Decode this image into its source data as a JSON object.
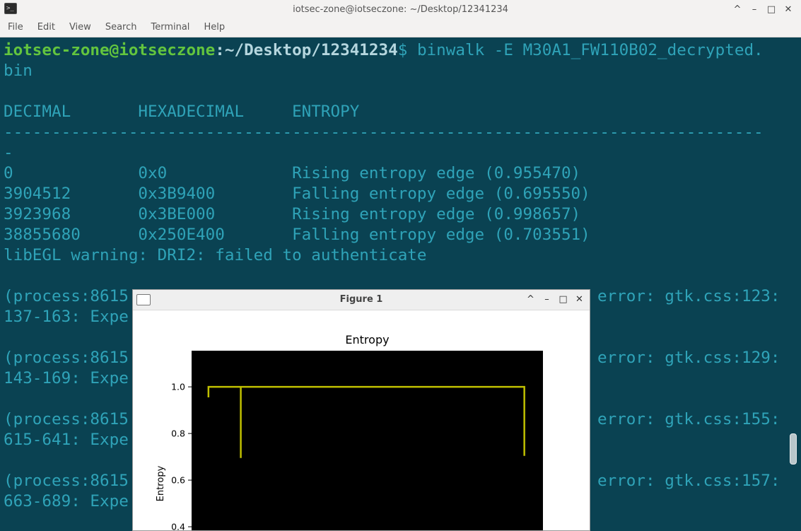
{
  "window": {
    "title": "iotsec-zone@iotseczone: ~/Desktop/12341234",
    "app_icon_glyph": ">_",
    "buttons": [
      "^",
      "–",
      "□",
      "✕"
    ]
  },
  "menu": [
    "File",
    "Edit",
    "View",
    "Search",
    "Terminal",
    "Help"
  ],
  "terminal": {
    "prompt_user": "iotsec-zone@iotseczone",
    "prompt_sep": ":",
    "prompt_path": "~/Desktop/12341234",
    "prompt_dollar": "$ ",
    "command": "binwalk -E M30A1_FW110B02_decrypted.",
    "command_wrap": "bin",
    "header": "DECIMAL       HEXADECIMAL     ENTROPY",
    "divider": "-------------------------------------------------------------------------------",
    "divider_wrap": "-",
    "rows": [
      "0             0x0             Rising entropy edge (0.955470)",
      "3904512       0x3B9400        Falling entropy edge (0.695550)",
      "3923968       0x3BE000        Rising entropy edge (0.998657)",
      "38855680      0x250E400       Falling entropy edge (0.703551)"
    ],
    "warning": "libEGL warning: DRI2: failed to authenticate",
    "errors": [
      {
        "left": "(process:8615",
        "right": "error: gtk.css:123:",
        "wrap": "137-163: Expe"
      },
      {
        "left": "(process:8615",
        "right": "error: gtk.css:129:",
        "wrap": "143-169: Expe"
      },
      {
        "left": "(process:8615",
        "right": "error: gtk.css:155:",
        "wrap": "615-641: Expe"
      },
      {
        "left": "(process:8615",
        "right": "error: gtk.css:157:",
        "wrap": "663-689: Expe"
      }
    ]
  },
  "figure": {
    "title": "Figure 1",
    "buttons": [
      "^",
      "–",
      "□",
      "✕"
    ]
  },
  "chart_data": {
    "type": "line",
    "title": "Entropy",
    "ylabel": "Entropy",
    "xlabel": "",
    "yticks": [
      1.0,
      0.8,
      0.6,
      0.4
    ],
    "ylim": [
      0.3,
      1.155
    ],
    "xlim": [
      0,
      10
    ],
    "series": [
      {
        "x": [
          0.48,
          0.48,
          1.4,
          1.4,
          1.4,
          9.47,
          9.47
        ],
        "y": [
          0.955,
          1.0,
          1.0,
          0.695,
          1.0,
          1.0,
          0.704
        ]
      }
    ],
    "background": "#000000",
    "line_color": "#bfbf00"
  }
}
